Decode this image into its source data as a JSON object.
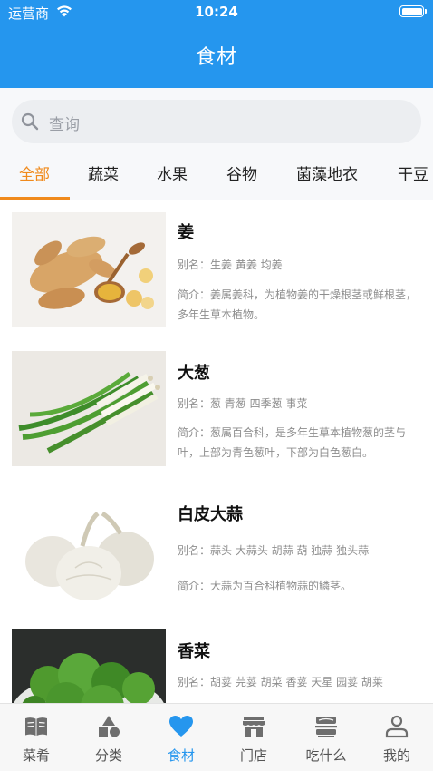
{
  "status_bar": {
    "carrier": "运营商",
    "time": "10:24"
  },
  "header": {
    "title": "食材"
  },
  "search": {
    "placeholder": "查询"
  },
  "category_tabs": [
    {
      "label": "全部",
      "active": true
    },
    {
      "label": "蔬菜",
      "active": false
    },
    {
      "label": "水果",
      "active": false
    },
    {
      "label": "谷物",
      "active": false
    },
    {
      "label": "菌藻地衣",
      "active": false
    },
    {
      "label": "干豆",
      "active": false
    }
  ],
  "ingredients": [
    {
      "name": "姜",
      "alias": "别名：生姜 黄姜 均姜",
      "intro": "简介：姜属姜科，为植物姜的干燥根茎或鲜根茎，多年生草本植物。",
      "image": "ginger-photo"
    },
    {
      "name": "大葱",
      "alias": "别名：葱 青葱 四季葱 事菜",
      "intro": "简介：葱属百合科，是多年生草本植物葱的茎与叶，上部为青色葱叶，下部为白色葱白。",
      "image": "scallion-photo"
    },
    {
      "name": "白皮大蒜",
      "alias": "别名：蒜头 大蒜头 胡蒜 葫 独蒜 独头蒜",
      "intro": "简介：大蒜为百合科植物蒜的鳞茎。",
      "image": "garlic-photo"
    },
    {
      "name": "香菜",
      "alias": "别名：胡荽 芫荽 胡菜 香荽 天星 园荽 胡莱",
      "intro": "",
      "image": "coriander-photo"
    }
  ],
  "tabbar": [
    {
      "label": "菜肴",
      "icon": "book-icon",
      "active": false
    },
    {
      "label": "分类",
      "icon": "shapes-icon",
      "active": false
    },
    {
      "label": "食材",
      "icon": "heart-icon",
      "active": true
    },
    {
      "label": "门店",
      "icon": "store-icon",
      "active": false
    },
    {
      "label": "吃什么",
      "icon": "food-icon",
      "active": false
    },
    {
      "label": "我的",
      "icon": "profile-icon",
      "active": false
    }
  ],
  "colors": {
    "primary": "#2596ee",
    "accent": "#f08a1c"
  }
}
